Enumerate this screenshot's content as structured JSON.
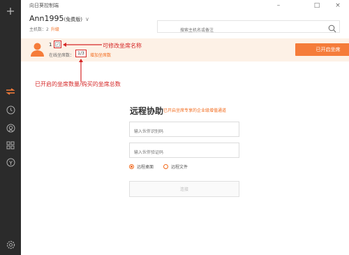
{
  "window": {
    "app_title": "向日葵控制端",
    "minimize_glyph": "–",
    "maximize_glyph": "□",
    "close_glyph": "×"
  },
  "account": {
    "name": "Ann1995",
    "edition": "(免费版)",
    "chevron": "∨",
    "host_label": "主机数：2",
    "upgrade_label": "升级"
  },
  "search": {
    "placeholder": "搜索主机名或备注"
  },
  "seat": {
    "number": "1",
    "online_label": "在线坐席数：",
    "ratio": "1/3",
    "add_seats_label": "增加坐席数",
    "opened_button": "已开启坐席"
  },
  "annotations": {
    "rename_hint": "可修改坐席名称",
    "ratio_hint": "已开启的坐席数量/购买的坐席总数"
  },
  "remote": {
    "title": "远程协助",
    "subtitle": "已开启坐席专享的企业级增值通道",
    "partner_id_placeholder": "输入伙伴识别码",
    "partner_code_placeholder": "输入伙伴验证码",
    "mode_desktop": "远程桌面",
    "mode_file": "远程文件",
    "connect_label": "连接"
  },
  "sidebar": {
    "icons": [
      "plus-icon",
      "transfer-icon",
      "clock-icon",
      "webcam-icon",
      "apps-icon",
      "discover-icon",
      "settings-icon"
    ]
  },
  "colors": {
    "accent": "#f26a1b",
    "annotation_red": "#d52828",
    "sidebar_bg": "#2b2b2b",
    "banner_bg": "#fdf1e6"
  }
}
